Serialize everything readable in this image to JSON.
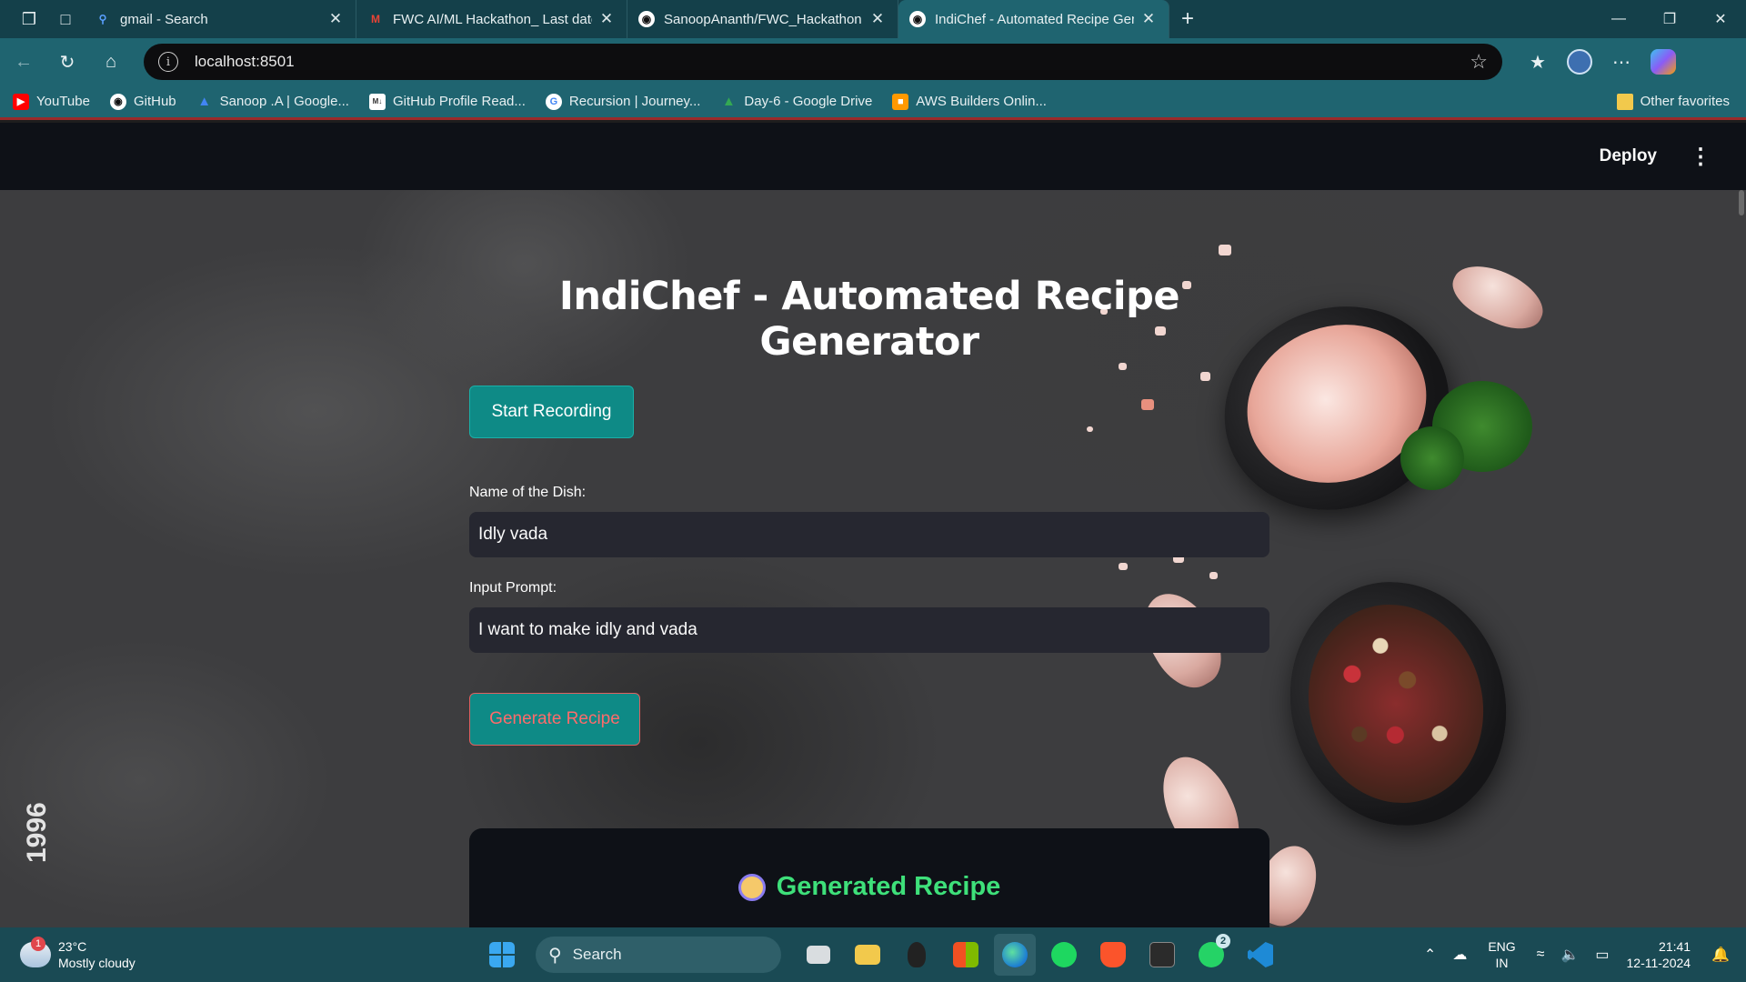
{
  "browser": {
    "tabs": [
      {
        "title": "gmail - Search",
        "icon": "search-icon"
      },
      {
        "title": "FWC AI/ML Hackathon_ Last date",
        "icon": "gmail-icon"
      },
      {
        "title": "SanoopAnanth/FWC_Hackathon",
        "icon": "github-icon"
      },
      {
        "title": "IndiChef - Automated Recipe Gen",
        "icon": "streamlit-icon",
        "active": true
      }
    ],
    "url": "localhost:8501",
    "bookmarks": [
      {
        "label": "YouTube",
        "icon": "youtube-icon",
        "color": "#ff0000"
      },
      {
        "label": "GitHub",
        "icon": "github-icon",
        "color": "#ffffff"
      },
      {
        "label": "Sanoop .A | Google...",
        "icon": "google-drive-icon",
        "color": "#4285f4"
      },
      {
        "label": "GitHub Profile Read...",
        "icon": "readme-icon",
        "color": "#ffffff"
      },
      {
        "label": "Recursion | Journey...",
        "icon": "google-icon",
        "color": "#ffffff"
      },
      {
        "label": "Day-6 - Google Drive",
        "icon": "google-drive-icon",
        "color": "#34a853"
      },
      {
        "label": "AWS Builders Onlin...",
        "icon": "aws-icon",
        "color": "#ff9900"
      }
    ],
    "other_favorites": "Other favorites"
  },
  "app": {
    "deploy_label": "Deploy",
    "title": "IndiChef - Automated Recipe Generator",
    "start_recording_label": "Start Recording",
    "dish_label": "Name of the Dish:",
    "dish_value": "Idly vada",
    "prompt_label": "Input Prompt:",
    "prompt_value": "I want to make idly and vada",
    "generate_label": "Generate Recipe",
    "recipe_heading": "Generated Recipe",
    "watermark": "1996"
  },
  "taskbar": {
    "weather_temp": "23°C",
    "weather_desc": "Mostly cloudy",
    "weather_badge": "1",
    "search_label": "Search",
    "whatsapp_badge": "2",
    "lang_line1": "ENG",
    "lang_line2": "IN",
    "time": "21:41",
    "date": "12-11-2024"
  },
  "colors": {
    "accent_teal": "#0e8a86",
    "recipe_green": "#3ee07a",
    "generate_text": "#ff6b6b"
  }
}
